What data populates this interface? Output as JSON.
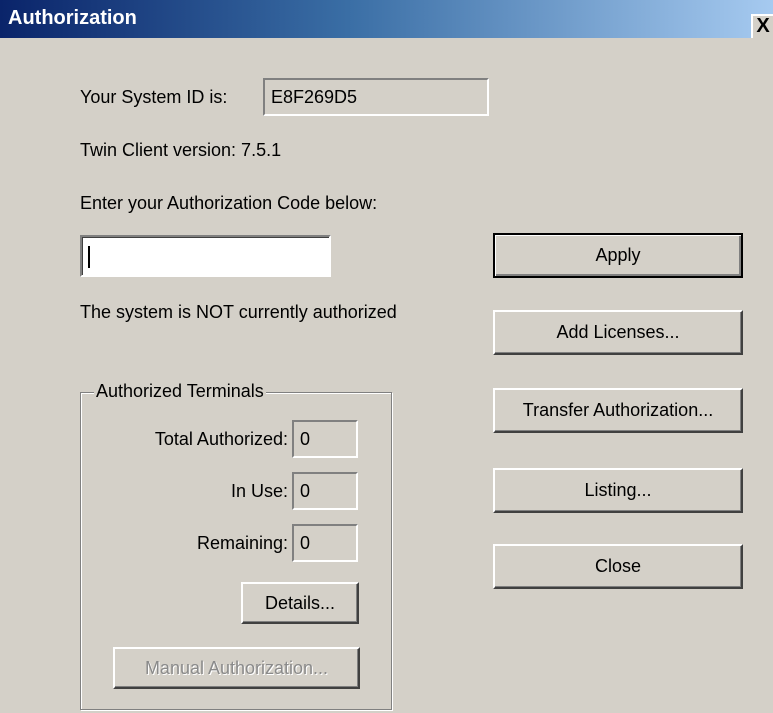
{
  "window": {
    "title": "Authorization",
    "close_glyph": "X"
  },
  "system_id": {
    "label": "Your System ID is:",
    "value": "E8F269D5"
  },
  "version": {
    "text": "Twin Client version: 7.5.1"
  },
  "auth_code": {
    "prompt": "Enter your Authorization Code below:",
    "value": ""
  },
  "status": {
    "text": "The system is NOT currently authorized"
  },
  "buttons": {
    "apply": "Apply",
    "add_licenses": "Add Licenses...",
    "transfer": "Transfer Authorization...",
    "listing": "Listing...",
    "close": "Close",
    "details": "Details...",
    "manual": "Manual Authorization..."
  },
  "terminals": {
    "group_title": "Authorized Terminals",
    "total_label": "Total Authorized:",
    "total_value": "0",
    "in_use_label": "In Use:",
    "in_use_value": "0",
    "remaining_label": "Remaining:",
    "remaining_value": "0"
  }
}
